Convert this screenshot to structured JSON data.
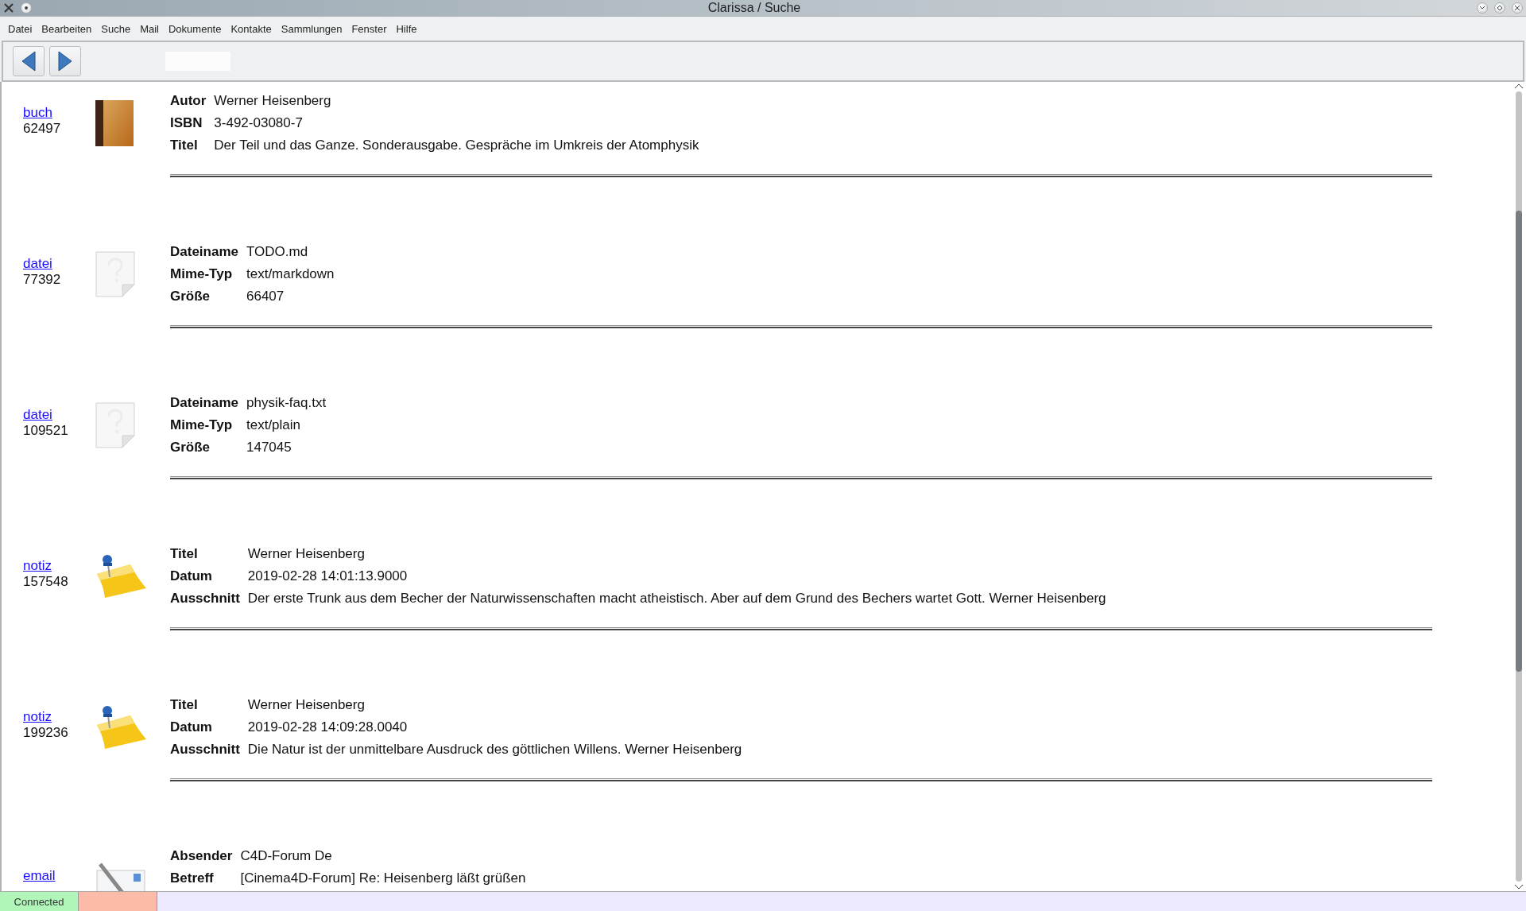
{
  "window": {
    "title": "Clarissa / Suche"
  },
  "menu": [
    "Datei",
    "Bearbeiten",
    "Suche",
    "Mail",
    "Dokumente",
    "Kontakte",
    "Sammlungen",
    "Fenster",
    "Hilfe"
  ],
  "results": [
    {
      "kind": "book",
      "link": "buch",
      "id": "62497",
      "fields": [
        {
          "label": "Autor",
          "value": "Werner Heisenberg"
        },
        {
          "label": "ISBN",
          "value": "3-492-03080-7"
        },
        {
          "label": "Titel",
          "value": "Der Teil und das Ganze. Sonderausgabe. Gespräche im Umkreis der Atomphysik"
        }
      ]
    },
    {
      "kind": "file",
      "link": "datei",
      "id": "77392",
      "fields": [
        {
          "label": "Dateiname",
          "value": "TODO.md"
        },
        {
          "label": "Mime-Typ",
          "value": "text/markdown"
        },
        {
          "label": "Größe",
          "value": "66407"
        }
      ]
    },
    {
      "kind": "file",
      "link": "datei",
      "id": "109521",
      "fields": [
        {
          "label": "Dateiname",
          "value": "physik-faq.txt"
        },
        {
          "label": "Mime-Typ",
          "value": "text/plain"
        },
        {
          "label": "Größe",
          "value": "147045"
        }
      ]
    },
    {
      "kind": "note",
      "link": "notiz",
      "id": "157548",
      "fields": [
        {
          "label": "Titel",
          "value": "Werner Heisenberg"
        },
        {
          "label": "Datum",
          "value": "2019-02-28 14:01:13.9000"
        },
        {
          "label": "Ausschnitt",
          "value": "Der erste Trunk aus dem Becher der Naturwissenschaften macht atheistisch. Aber auf dem Grund des Bechers wartet Gott. Werner Heisenberg"
        }
      ]
    },
    {
      "kind": "note",
      "link": "notiz",
      "id": "199236",
      "fields": [
        {
          "label": "Titel",
          "value": "Werner Heisenberg"
        },
        {
          "label": "Datum",
          "value": "2019-02-28 14:09:28.0040"
        },
        {
          "label": "Ausschnitt",
          "value": "Die Natur ist der unmittelbare Ausdruck des göttlichen Willens. Werner Heisenberg"
        }
      ]
    },
    {
      "kind": "email",
      "link": "email",
      "fields": [
        {
          "label": "Absender",
          "value": "C4D-Forum De"
        },
        {
          "label": "Betreff",
          "value": "[Cinema4D-Forum] Re: Heisenberg läßt grüßen"
        }
      ]
    }
  ],
  "status_bar": {
    "connection": "Connected"
  }
}
